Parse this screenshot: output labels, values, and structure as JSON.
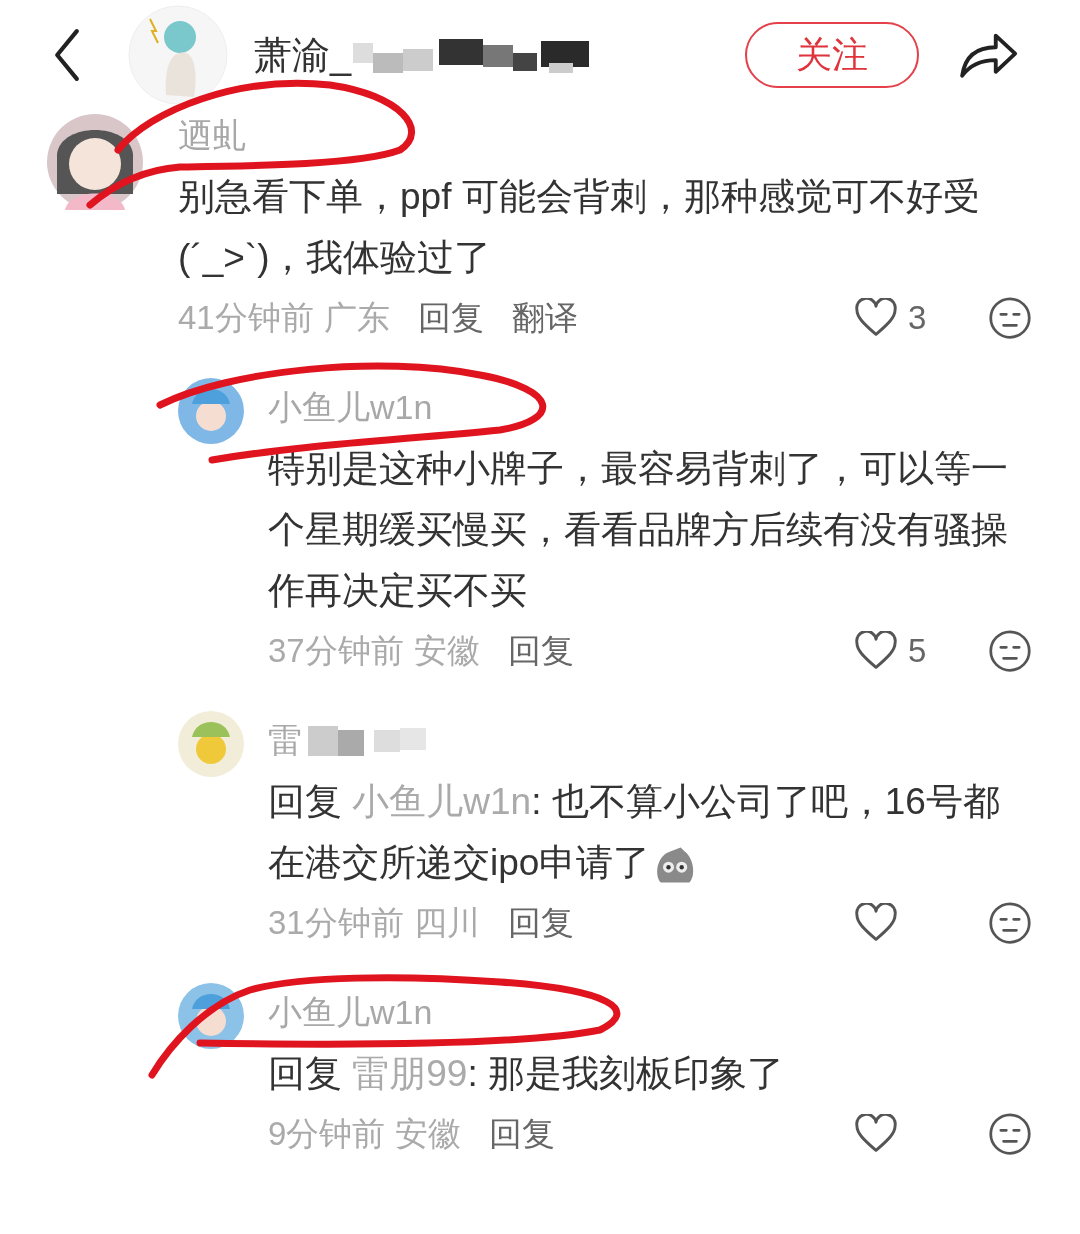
{
  "header": {
    "author_name": "萧渝_",
    "follow_button": "关注"
  },
  "comments": [
    {
      "author": "迺虬",
      "text": "别急看下单，ppf 可能会背刺，那种感觉可不好受(´_>`)，我体验过了",
      "time": "41分钟前",
      "location": "广东",
      "actions": [
        "回复",
        "翻译"
      ],
      "likes": "3",
      "children": [
        {
          "author": "小鱼儿w1n",
          "text": "特别是这种小牌子，最容易背刺了，可以等一个星期缓买慢买，看看品牌方后续有没有骚操作再决定买不买",
          "time": "37分钟前",
          "location": "安徽",
          "actions": [
            "回复"
          ],
          "likes": "5"
        },
        {
          "author": "雷",
          "author_masked": true,
          "reply_prefix": "回复",
          "reply_to": "小鱼儿w1n",
          "text": ": 也不算小公司了吧，16号都在港交所递交ipo申请了",
          "sticker": true,
          "time": "31分钟前",
          "location": "四川",
          "actions": [
            "回复"
          ]
        },
        {
          "author": "小鱼儿w1n",
          "reply_prefix": "回复",
          "reply_to": "雷朋99",
          "text": ": 那是我刻板印象了",
          "time": "9分钟前",
          "location": "安徽",
          "actions": [
            "回复"
          ]
        }
      ]
    }
  ]
}
